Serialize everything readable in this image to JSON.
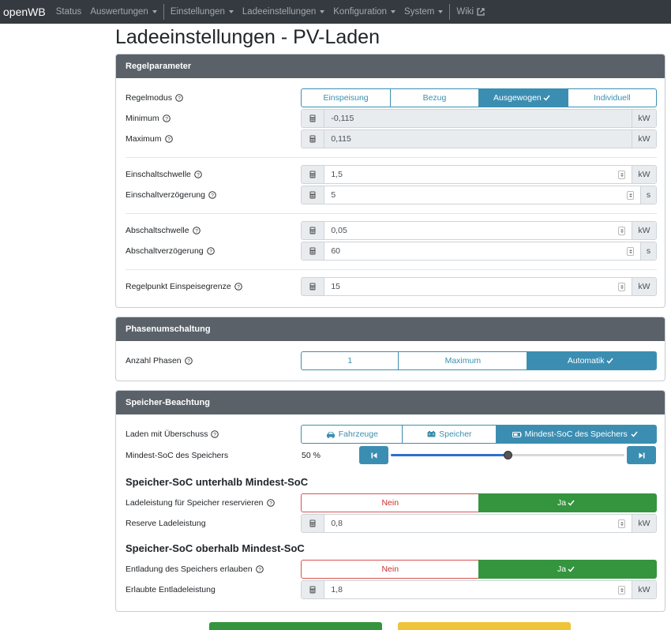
{
  "navbar": {
    "brand": "openWB",
    "items": [
      {
        "label": "Status",
        "dropdown": false
      },
      {
        "label": "Auswertungen",
        "dropdown": true
      },
      {
        "label": "Einstellungen",
        "dropdown": true
      },
      {
        "label": "Ladeeinstellungen",
        "dropdown": true
      },
      {
        "label": "Konfiguration",
        "dropdown": true
      },
      {
        "label": "System",
        "dropdown": true
      },
      {
        "label": "Wiki",
        "dropdown": false
      }
    ]
  },
  "page": {
    "title": "Ladeeinstellungen - PV-Laden"
  },
  "regelparameter": {
    "header": "Regelparameter",
    "regelmodus": {
      "label": "Regelmodus",
      "options": [
        "Einspeisung",
        "Bezug",
        "Ausgewogen",
        "Individuell"
      ],
      "selected": "Ausgewogen"
    },
    "minimum": {
      "label": "Minimum",
      "value": "-0,115",
      "unit": "kW"
    },
    "maximum": {
      "label": "Maximum",
      "value": "0,115",
      "unit": "kW"
    },
    "einschaltschwelle": {
      "label": "Einschaltschwelle",
      "value": "1,5",
      "unit": "kW"
    },
    "einschaltverzoegerung": {
      "label": "Einschaltverzögerung",
      "value": "5",
      "unit": "s"
    },
    "abschaltschwelle": {
      "label": "Abschaltschwelle",
      "value": "0,05",
      "unit": "kW"
    },
    "abschaltverzoegerung": {
      "label": "Abschaltverzögerung",
      "value": "60",
      "unit": "s"
    },
    "regelpunkt": {
      "label": "Regelpunkt Einspeisegrenze",
      "value": "15",
      "unit": "kW"
    }
  },
  "phasenumschaltung": {
    "header": "Phasenumschaltung",
    "anzahl_phasen": {
      "label": "Anzahl Phasen",
      "options": [
        "1",
        "Maximum",
        "Automatik"
      ],
      "selected": "Automatik"
    }
  },
  "speicher": {
    "header": "Speicher-Beachtung",
    "laden_ueberschuss": {
      "label": "Laden mit Überschuss",
      "options": [
        "Fahrzeuge",
        "Speicher",
        "Mindest-SoC des Speichers"
      ],
      "selected": "Mindest-SoC des Speichers"
    },
    "mindest_soc": {
      "label": "Mindest-SoC des Speichers",
      "value_text": "50 %",
      "fraction": 0.5
    },
    "unterhalb_heading": "Speicher-SoC unterhalb Mindest-SoC",
    "ladeleistung_reservieren": {
      "label": "Ladeleistung für Speicher reservieren",
      "no": "Nein",
      "yes": "Ja",
      "selected": "Ja"
    },
    "reserve_ladeleistung": {
      "label": "Reserve Ladeleistung",
      "value": "0,8",
      "unit": "kW"
    },
    "oberhalb_heading": "Speicher-SoC oberhalb Mindest-SoC",
    "entladung_erlauben": {
      "label": "Entladung des Speichers erlauben",
      "no": "Nein",
      "yes": "Ja",
      "selected": "Ja"
    },
    "erlaubte_entladeleistung": {
      "label": "Erlaubte Entladeleistung",
      "value": "1,8",
      "unit": "kW"
    }
  },
  "colors": {
    "navbar_bg": "#343a40",
    "card_header_bg": "#5a6169",
    "accent": "#3b8eb2",
    "success": "#34953e",
    "danger": "#d9534f",
    "warning": "#f0c43a"
  }
}
